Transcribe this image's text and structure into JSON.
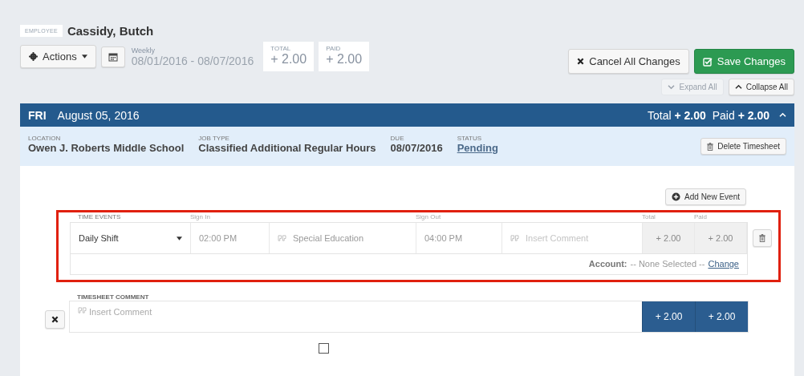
{
  "employee": {
    "label": "EMPLOYEE",
    "name": "Cassidy, Butch"
  },
  "toolbar": {
    "actions": "Actions",
    "period": {
      "label": "Weekly",
      "range": "08/01/2016 - 08/07/2016"
    },
    "totals": [
      {
        "label": "TOTAL",
        "value": "+ 2.00"
      },
      {
        "label": "PAID",
        "value": "+ 2.00"
      }
    ],
    "buttons": [
      {
        "kind": "cancel",
        "label": "Cancel All Changes"
      },
      {
        "kind": "save",
        "label": "Save Changes"
      }
    ],
    "expand": {
      "label": "Expand All",
      "disabled": true
    },
    "collapse": {
      "label": "Collapse All",
      "disabled": false
    }
  },
  "day": {
    "weekday": "FRI",
    "date": "August 05, 2016",
    "total_label": "Total",
    "total": "+ 2.00",
    "paid_label": "Paid",
    "paid": "+ 2.00",
    "expanded": true,
    "fields": [
      {
        "label": "LOCATION",
        "value": "Owen J. Roberts Middle School"
      },
      {
        "label": "JOB TYPE",
        "value": "Classified Additional Regular Hours"
      },
      {
        "label": "DUE",
        "value": "08/07/2016"
      }
    ],
    "status": {
      "label": "STATUS",
      "value": "Pending"
    },
    "delete": "Delete Timesheet"
  },
  "events": {
    "add": "Add New Event",
    "highlighted": true,
    "columns": [
      "TIME EVENTS",
      "Sign In",
      "Sign Out",
      "Total",
      "Paid"
    ],
    "rows": [
      {
        "type": "Daily Shift",
        "sign_in": "02:00 PM",
        "sign_in_comment": "Special Education",
        "sign_out": "04:00 PM",
        "sign_out_comment_placeholder": "Insert Comment",
        "total": "+ 2.00",
        "paid": "+ 2.00",
        "account_label": "Account:",
        "account": "-- None Selected --",
        "change": "Change"
      }
    ]
  },
  "comment": {
    "label": "TIMESHEET COMMENT",
    "placeholder": "Insert Comment",
    "total": "+ 2.00",
    "paid": "+ 2.00",
    "checkbox": {
      "checked": false
    }
  }
}
